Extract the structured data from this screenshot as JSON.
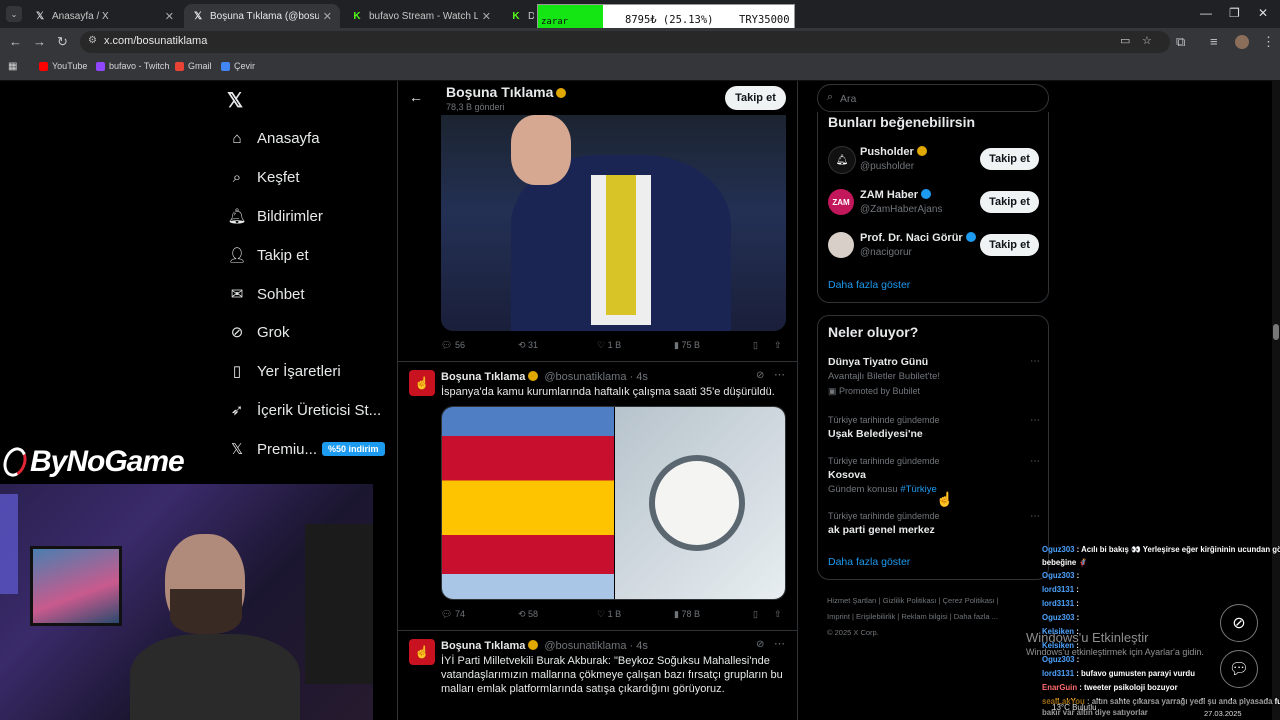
{
  "browser": {
    "tabs": [
      {
        "title": "Anasayfa / X",
        "icon": "x-logo"
      },
      {
        "title": "Boşuna Tıklama (@bosunatiklama) / X",
        "icon": "x-logo"
      },
      {
        "title": "bufavo Stream - Watch Live on Kick",
        "icon": "kick-logo"
      },
      {
        "title": "Dro",
        "icon": "kick-logo"
      }
    ],
    "url": "x.com/bosunatiklama",
    "bookmarks": [
      {
        "label": "YouTube",
        "color": "#ff0000"
      },
      {
        "label": "bufavo - Twitch",
        "color": "#9146ff"
      },
      {
        "label": "Gmail",
        "color": "#ea4335"
      },
      {
        "label": "Çevir",
        "color": "#4285f4"
      }
    ]
  },
  "stock_widget": {
    "status": "zarar",
    "value": "8795₺ (25.13%)",
    "target": "TRY35000"
  },
  "nav": {
    "items": [
      {
        "label": "Anasayfa",
        "icon": "home-icon"
      },
      {
        "label": "Keşfet",
        "icon": "search-icon"
      },
      {
        "label": "Bildirimler",
        "icon": "bell-icon"
      },
      {
        "label": "Takip et",
        "icon": "follow-icon"
      },
      {
        "label": "Sohbet",
        "icon": "mail-icon"
      },
      {
        "label": "Grok",
        "icon": "grok-icon"
      },
      {
        "label": "Yer İşaretleri",
        "icon": "bookmark-icon"
      },
      {
        "label": "İçerik Üreticisi St...",
        "icon": "rocket-icon"
      },
      {
        "label": "Premiu...",
        "icon": "x-icon"
      }
    ],
    "premium_badge": "%50 indirim"
  },
  "profile_header": {
    "name": "Boşuna Tıklama",
    "posts": "78,3 B gönderi",
    "follow": "Takip et"
  },
  "tweets": [
    {
      "stats": {
        "replies": "56",
        "retweets": "31",
        "likes": "1 B",
        "views": "75 B"
      }
    },
    {
      "name": "Boşuna Tıklama",
      "handle": "@bosunatiklama · 4s",
      "text": "İspanya'da kamu kurumlarında haftalık çalışma saati 35'e düşürüldü.",
      "stats": {
        "replies": "74",
        "retweets": "58",
        "likes": "1 B",
        "views": "78 B"
      }
    },
    {
      "name": "Boşuna Tıklama",
      "handle": "@bosunatiklama · 4s",
      "text": "İYİ Parti Milletvekili Burak Akburak: \"Beykoz Soğuksu Mahallesi'nde vatandaşlarımızın mallarına çökmeye çalışan bazı fırsatçı grupların bu malları emlak platformlarında satışa çıkardığını görüyoruz."
    }
  ],
  "right": {
    "search_placeholder": "Ara",
    "suggest_title": "Bunları beğenebilirsin",
    "suggestions": [
      {
        "name": "Pusholder",
        "handle": "@pusholder",
        "follow": "Takip et"
      },
      {
        "name": "ZAM Haber",
        "handle": "@ZamHaberAjans",
        "follow": "Takip et"
      },
      {
        "name": "Prof. Dr. Naci Görür",
        "handle": "@nacigorur",
        "follow": "Takip et"
      }
    ],
    "show_more": "Daha fazla göster",
    "trends_title": "Neler oluyor?",
    "trends": [
      {
        "context": "",
        "title": "Dünya Tiyatro Günü",
        "sub": "Avantajlı Biletler Bubilet'te!",
        "promo": "Promoted by Bubilet"
      },
      {
        "context": "Türkiye tarihinde gündemde",
        "title": "Uşak Belediyesi'ne",
        "sub": ""
      },
      {
        "context": "Türkiye tarihinde gündemde",
        "title": "Kosova",
        "sub": "Gündem konusu",
        "tag": "#Türkiye"
      },
      {
        "context": "Türkiye tarihinde gündemde",
        "title": "ak parti genel merkez",
        "sub": ""
      }
    ],
    "trends_more": "Daha fazla göster",
    "footer": [
      "Hizmet Şartları",
      "Gizlilik Politikası",
      "Çerez Politikası",
      "Imprint",
      "Erişilebilirlik",
      "Reklam bilgisi",
      "Daha fazla ...",
      "© 2025 X Corp."
    ]
  },
  "overlay": {
    "brand": "ByNoGame",
    "windows_line1": "Windows'u Etkinleştir",
    "windows_line2": "Windows'u etkinleştirmek için Ayarlar'a gidin.",
    "weather": "13°C  Bulutlu",
    "date": "27.03.2025"
  },
  "chat": [
    {
      "user": "Oguz303",
      "msg": ": Acılı bi bakış 👀 Yerleşirse eğer kirğininin ucundan göz"
    },
    {
      "user": "",
      "msg": "bebeğine 🦸"
    },
    {
      "user": "Oguz303",
      "msg": ":"
    },
    {
      "user": "lord3131",
      "msg": ":"
    },
    {
      "user": "lord3131",
      "msg": ":"
    },
    {
      "user": "Oguz303",
      "msg": ":"
    },
    {
      "user": "Kelsiken",
      "msg": ":"
    },
    {
      "user": "Kelsiken",
      "msg": ":"
    },
    {
      "user": "Oguz303",
      "msg": ":"
    },
    {
      "user": "lord3131",
      "msg": ": bufavo gumusten parayi vurdu"
    },
    {
      "user": "EnarGuin",
      "msg": ": tweeter psikoloji bozuyor"
    },
    {
      "user": "sealLakYou",
      "msg": ": altın sahte çıkarsa yarrağı yedi şu anda piyasada full"
    },
    {
      "user": "",
      "msg": "bakır var altın diye satıyorlar"
    }
  ]
}
